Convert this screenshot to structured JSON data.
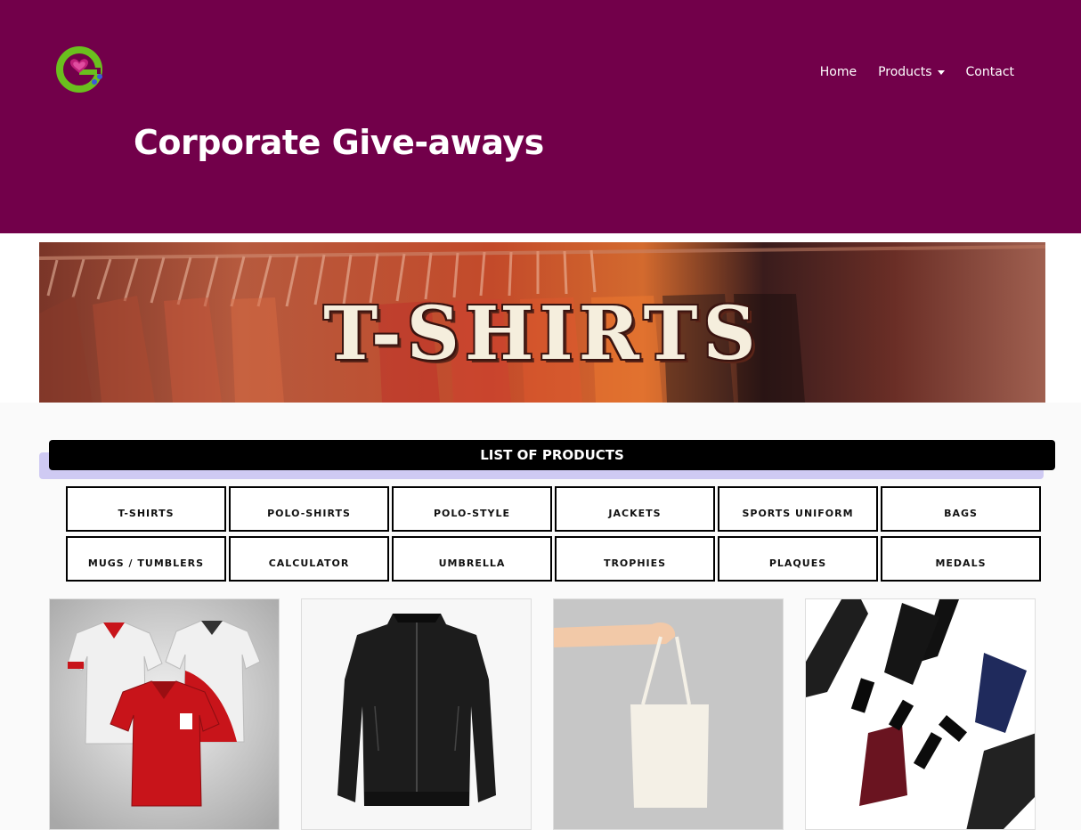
{
  "header": {
    "nav": {
      "home": "Home",
      "products": "Products",
      "contact": "Contact"
    },
    "title": "Corporate Give-aways",
    "bg_color": "#72004a"
  },
  "banner": {
    "text": "T-SHIRTS"
  },
  "products_section": {
    "heading": "LIST OF PRODUCTS",
    "categories": [
      "T-SHIRTS",
      "POLO-SHIRTS",
      "POLO-STYLE",
      "JACKETS",
      "SPORTS UNIFORM",
      "BAGS",
      "MUGS / TUMBLERS",
      "CALCULATOR",
      "UMBRELLA",
      "TROPHIES",
      "PLAQUES",
      "MEDALS"
    ]
  },
  "cards": [
    {
      "image": "polo-shirts-photo"
    },
    {
      "image": "jacket-photo"
    },
    {
      "image": "tote-bag-photo"
    },
    {
      "image": "umbrellas-photo"
    }
  ]
}
